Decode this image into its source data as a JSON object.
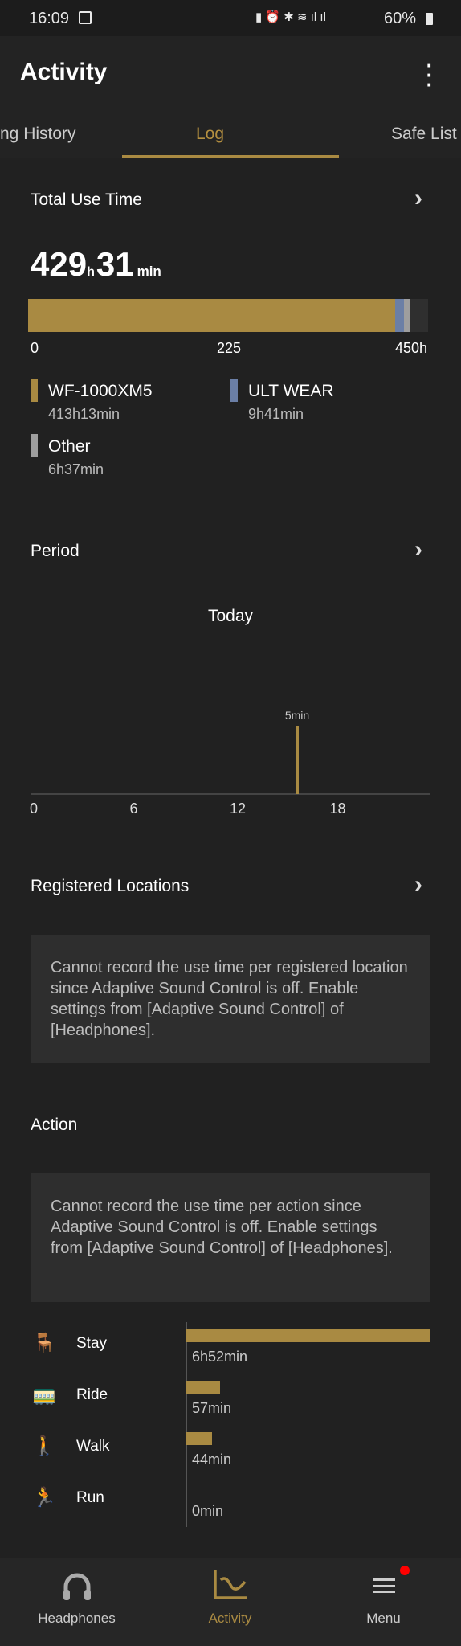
{
  "status_bar": {
    "time": "16:09",
    "battery": "60%"
  },
  "app_bar": {
    "title": "Activity",
    "more_icon": "more-vert-icon"
  },
  "tabs": [
    {
      "label": "ng History"
    },
    {
      "label": "Log",
      "active": true
    },
    {
      "label": "Safe List"
    }
  ],
  "accent": "#a98a42",
  "total_use": {
    "heading": "Total Use Time",
    "hours": "429",
    "h_unit": "h",
    "minutes": "31",
    "min_unit": "min",
    "axis_ticks": [
      "0",
      "225",
      "450h"
    ],
    "axis_max_hours": 450,
    "devices": [
      {
        "name": "WF-1000XM5",
        "time": "413h13min",
        "hours": 413.22,
        "color": "#a98a42"
      },
      {
        "name": "ULT WEAR",
        "time": "9h41min",
        "hours": 9.68,
        "color": "#6b7fa6"
      },
      {
        "name": "Other",
        "time": "6h37min",
        "hours": 6.62,
        "color": "#9e9e9e"
      }
    ]
  },
  "period": {
    "heading": "Period",
    "label": "Today",
    "chart_data": {
      "type": "bar",
      "x_ticks": [
        "0",
        "6",
        "12",
        "18"
      ],
      "xlim": [
        0,
        24
      ],
      "bars": [
        {
          "hour": 16,
          "label": "5min",
          "minutes": 5
        }
      ]
    }
  },
  "registered_locations": {
    "heading": "Registered Locations",
    "message": "Cannot record the use time per registered location since Adaptive Sound Control is off. Enable settings from [Adaptive Sound Control] of [Headphones]."
  },
  "action": {
    "heading": "Action",
    "message": "Cannot record the use time per action since Adaptive Sound Control is off. Enable settings from [Adaptive Sound Control] of [Headphones].",
    "chart_data": {
      "type": "bar",
      "categories": [
        "Stay",
        "Ride",
        "Walk",
        "Run"
      ],
      "labels": [
        "6h52min",
        "57min",
        "44min",
        "0min"
      ],
      "values_min": [
        412,
        57,
        44,
        0
      ]
    }
  },
  "bottom_nav": [
    {
      "label": "Headphones"
    },
    {
      "label": "Activity",
      "active": true
    },
    {
      "label": "Menu",
      "badge": true
    }
  ]
}
